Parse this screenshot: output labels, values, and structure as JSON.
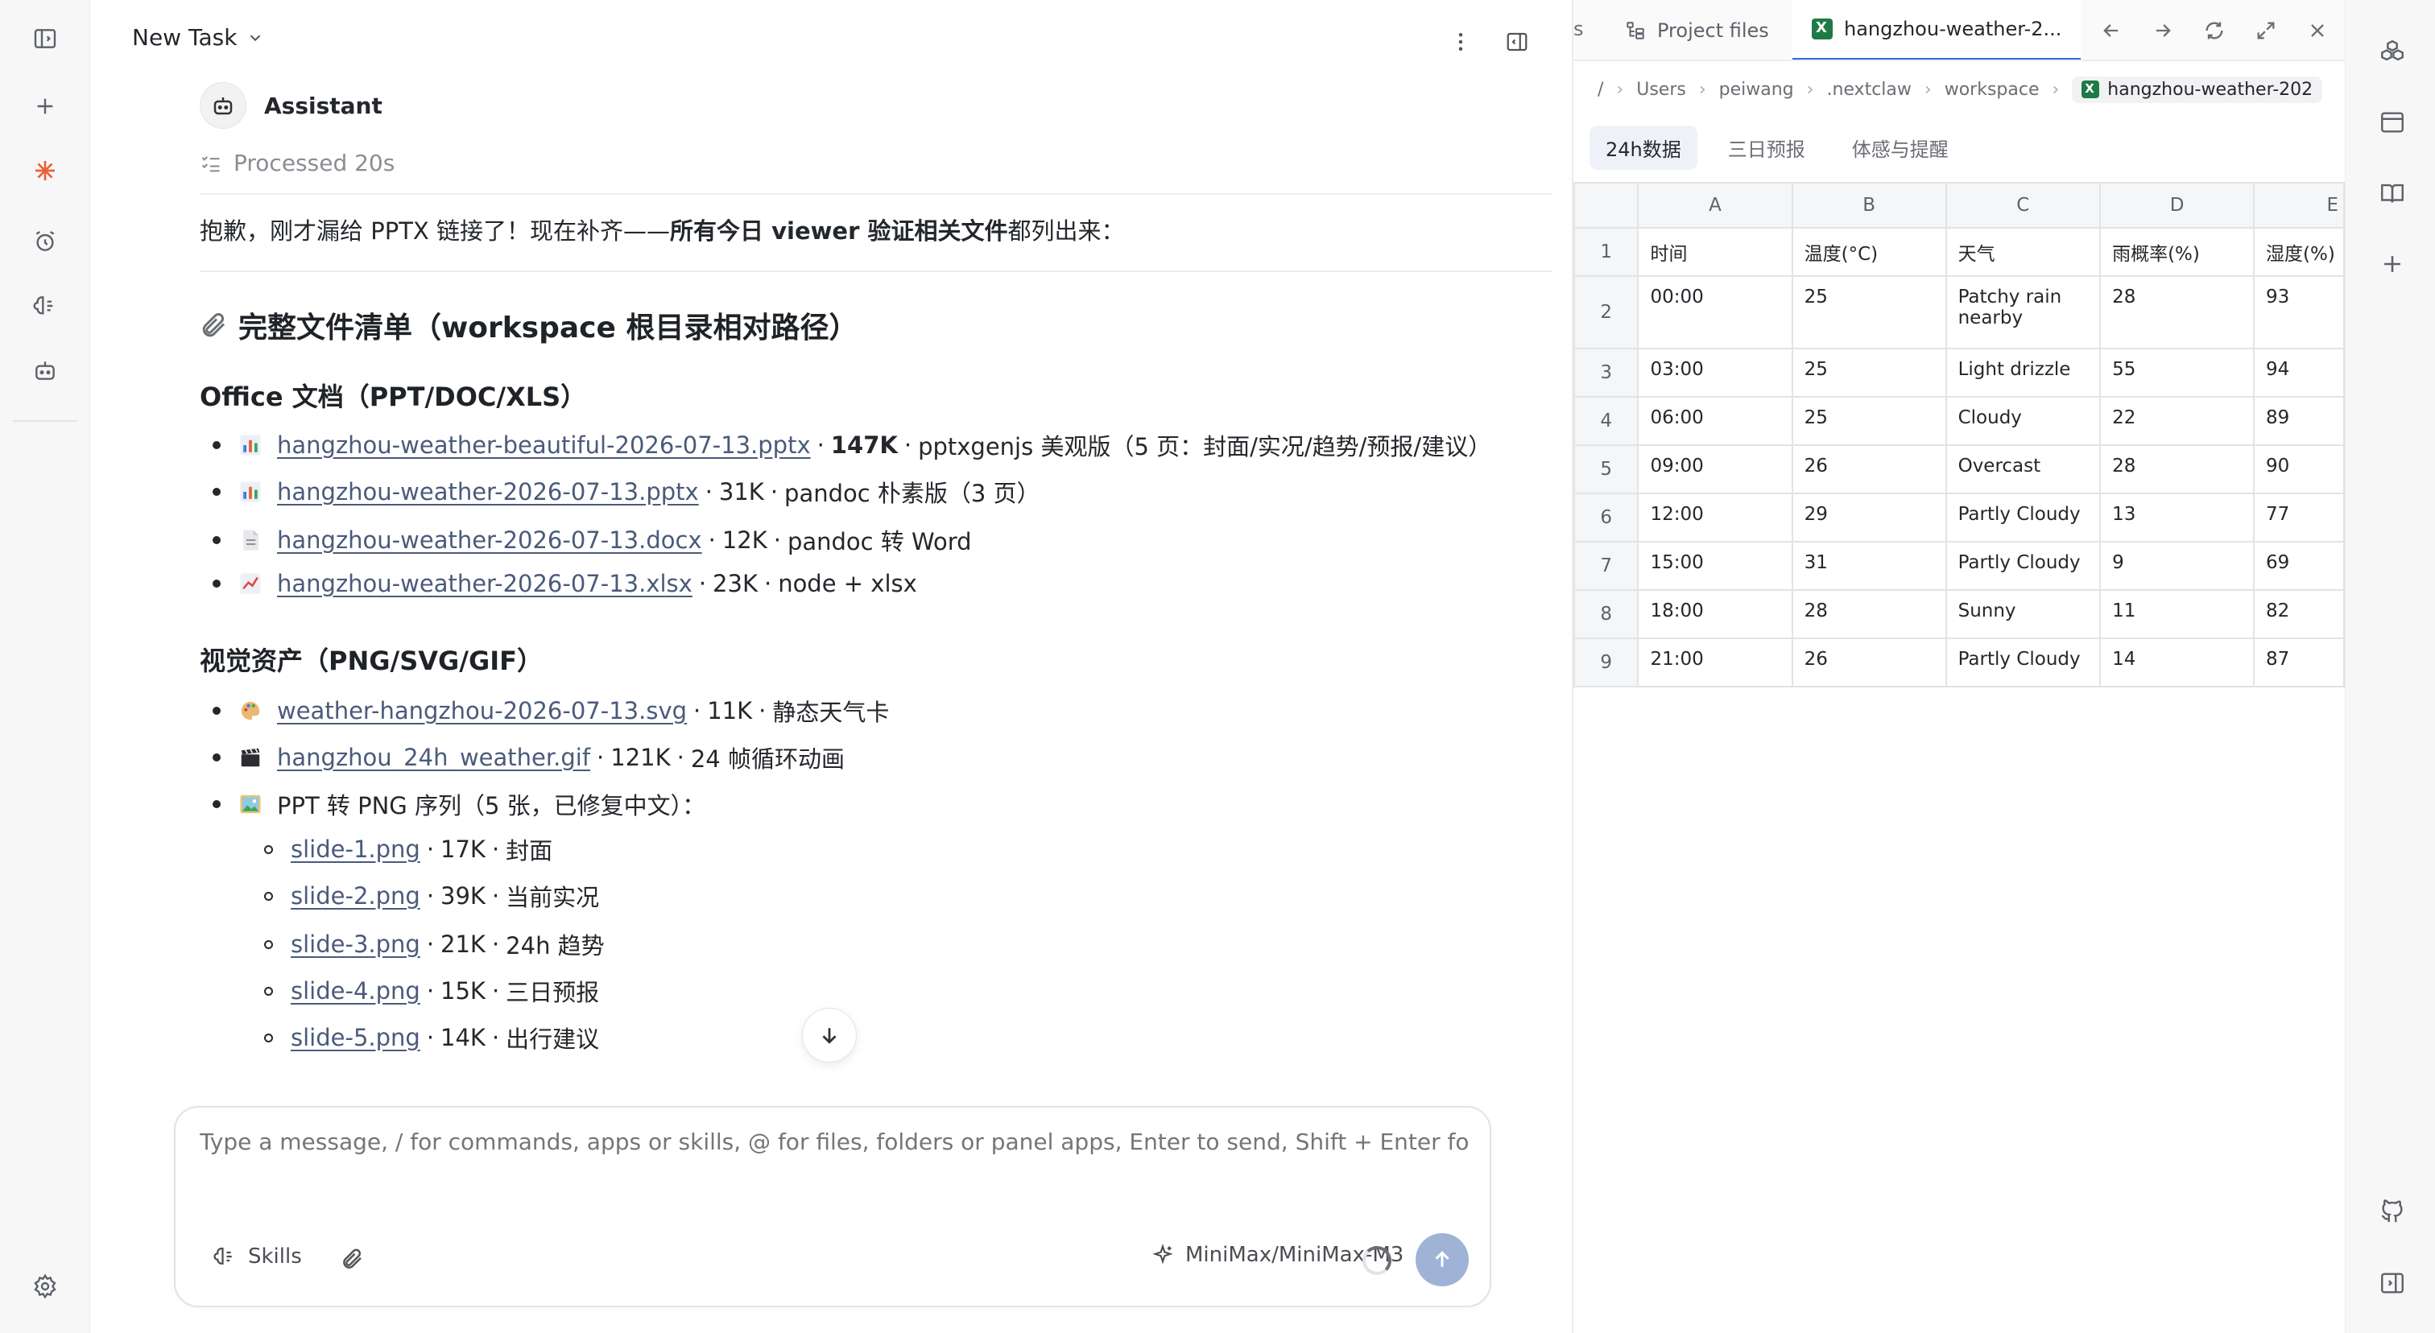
{
  "header": {
    "title": "New Task"
  },
  "assistant": {
    "name": "Assistant",
    "processed": "Processed 20s"
  },
  "message": {
    "intro_prefix": "抱歉，刚才漏给 PPTX 链接了！现在补齐——",
    "intro_bold": "所有今日 viewer 验证相关文件",
    "intro_suffix": "都列出来：",
    "heading": "完整文件清单（workspace 根目录相对路径）",
    "office_heading": "Office 文档（PPT/DOC/XLS）",
    "office_files": [
      {
        "icon": "bar-chart-icon",
        "name": "hangzhou-weather-beautiful-2026-07-13.pptx",
        "size": "147K",
        "desc": "pptxgenjs 美观版（5 页：封面/实况/趋势/预报/建议）"
      },
      {
        "icon": "bar-chart-icon",
        "name": "hangzhou-weather-2026-07-13.pptx",
        "size": "31K",
        "desc": "pandoc 朴素版（3 页）"
      },
      {
        "icon": "document-icon",
        "name": "hangzhou-weather-2026-07-13.docx",
        "size": "12K",
        "desc": "pandoc 转 Word"
      },
      {
        "icon": "line-chart-icon",
        "name": "hangzhou-weather-2026-07-13.xlsx",
        "size": "23K",
        "desc": "node + xlsx"
      }
    ],
    "visual_heading": "视觉资产（PNG/SVG/GIF）",
    "visual_files": [
      {
        "icon": "palette-icon",
        "name": "weather-hangzhou-2026-07-13.svg",
        "size": "11K",
        "desc": "静态天气卡"
      },
      {
        "icon": "clapper-icon",
        "name": "hangzhou_24h_weather.gif",
        "size": "121K",
        "desc": "24 帧循环动画"
      }
    ],
    "png_series_label": "PPT 转 PNG 序列（5 张，已修复中文）：",
    "png_files": [
      {
        "name": "slide-1.png",
        "size": "17K",
        "desc": "封面"
      },
      {
        "name": "slide-2.png",
        "size": "39K",
        "desc": "当前实况"
      },
      {
        "name": "slide-3.png",
        "size": "21K",
        "desc": "24h 趋势"
      },
      {
        "name": "slide-4.png",
        "size": "15K",
        "desc": "三日预报"
      },
      {
        "name": "slide-5.png",
        "size": "14K",
        "desc": "出行建议"
      }
    ],
    "separator": "·"
  },
  "composer": {
    "placeholder": "Type a message, / for commands, apps or skills, @ for files, folders or panel apps, Enter to send, Shift + Enter for newline",
    "skills_label": "Skills",
    "model_label": "MiniMax/MiniMax-M3"
  },
  "panel": {
    "tab_cut": "s",
    "tabs": [
      {
        "label": "Project files"
      },
      {
        "label": "hangzhou-weather-2..."
      }
    ],
    "breadcrumbs": [
      "/",
      "Users",
      "peiwang",
      ".nextclaw",
      "workspace"
    ],
    "breadcrumb_file": "hangzhou-weather-202",
    "sheet_tabs": [
      "24h数据",
      "三日预报",
      "体感与提醒"
    ],
    "columns": [
      "A",
      "B",
      "C",
      "D",
      "E"
    ],
    "rows": [
      {
        "n": "1",
        "cells": [
          "时间",
          "温度(°C)",
          "天气",
          "雨概率(%)",
          "湿度(%)"
        ]
      },
      {
        "n": "2",
        "cells": [
          "00:00",
          "25",
          "Patchy rain nearby",
          "28",
          "93"
        ]
      },
      {
        "n": "3",
        "cells": [
          "03:00",
          "25",
          "Light drizzle",
          "55",
          "94"
        ]
      },
      {
        "n": "4",
        "cells": [
          "06:00",
          "25",
          "Cloudy",
          "22",
          "89"
        ]
      },
      {
        "n": "5",
        "cells": [
          "09:00",
          "26",
          "Overcast",
          "28",
          "90"
        ]
      },
      {
        "n": "6",
        "cells": [
          "12:00",
          "29",
          "Partly Cloudy",
          "13",
          "77"
        ]
      },
      {
        "n": "7",
        "cells": [
          "15:00",
          "31",
          "Partly Cloudy",
          "9",
          "69"
        ]
      },
      {
        "n": "8",
        "cells": [
          "18:00",
          "28",
          "Sunny",
          "11",
          "82"
        ]
      },
      {
        "n": "9",
        "cells": [
          "21:00",
          "26",
          "Partly Cloudy",
          "14",
          "87"
        ]
      }
    ]
  },
  "colors": {
    "accent": "#2b6cd9",
    "link": "#4a5a7a",
    "send": "#9fb3d7",
    "brand_orange": "#e8603a",
    "excel_green": "#1f7a45"
  }
}
